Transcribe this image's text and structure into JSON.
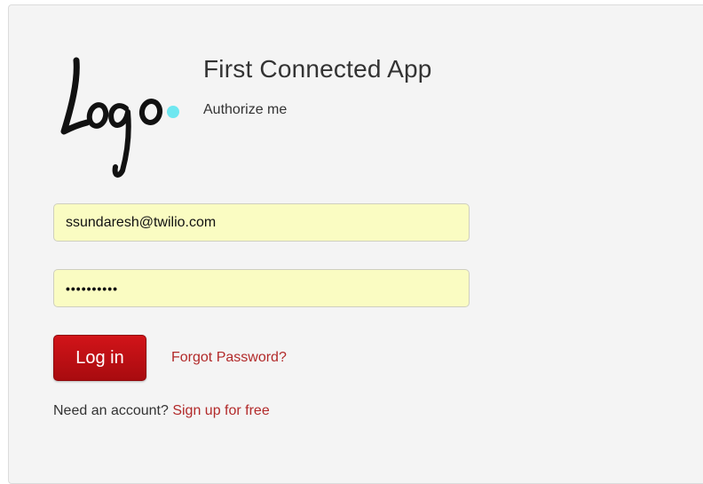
{
  "app": {
    "logo_text": "Logo",
    "title": "First Connected App",
    "subtitle": "Authorize me"
  },
  "form": {
    "email_value": "ssundaresh@twilio.com",
    "password_value": "••••••••••",
    "login_label": "Log in",
    "forgot_label": "Forgot Password?",
    "signup_prompt": "Need an account?",
    "signup_label": "Sign up for free"
  },
  "colors": {
    "brand_red": "#c0161b",
    "link_red": "#b22a2a",
    "autofill_yellow": "#fafcc2",
    "logo_dot": "#6ee7f0"
  }
}
